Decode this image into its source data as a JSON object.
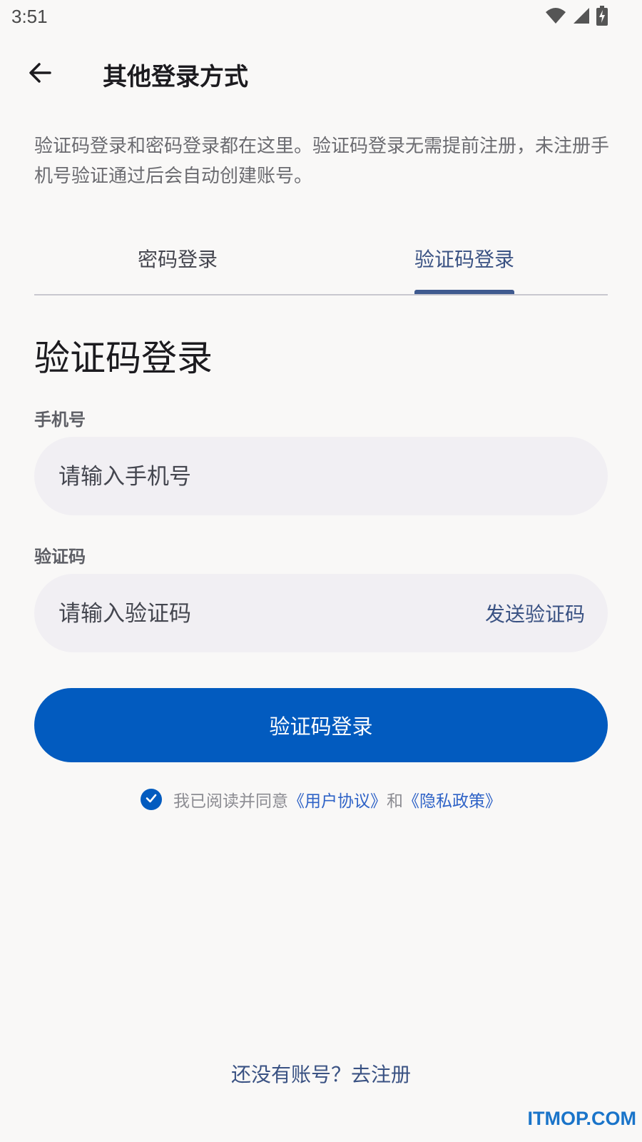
{
  "status_bar": {
    "time": "3:51",
    "icons": [
      "wifi-icon",
      "cellular-signal-icon",
      "battery-charging-icon"
    ]
  },
  "app_bar": {
    "back_icon": "arrow-left-icon",
    "title": "其他登录方式"
  },
  "description": "验证码登录和密码登录都在这里。验证码登录无需提前注册，未注册手机号验证通过后会自动创建账号。",
  "tabs": [
    {
      "label": "密码登录",
      "selected": false
    },
    {
      "label": "验证码登录",
      "selected": true
    }
  ],
  "form": {
    "title": "验证码登录",
    "phone": {
      "label": "手机号",
      "placeholder": "请输入手机号",
      "value": ""
    },
    "code": {
      "label": "验证码",
      "placeholder": "请输入验证码",
      "value": "",
      "send_label": "发送验证码"
    },
    "submit_label": "验证码登录"
  },
  "agreement": {
    "checked": true,
    "prefix": "我已阅读并同意",
    "user_agreement": "《用户协议》",
    "conjunction": "和",
    "privacy_policy": "《隐私政策》"
  },
  "register_link": "还没有账号？去注册",
  "watermark": "ITMOP.COM",
  "colors": {
    "primary": "#025bbf",
    "tab_active": "#3a5283",
    "background": "#f9f8f7",
    "input_bg": "#f1eff3"
  }
}
